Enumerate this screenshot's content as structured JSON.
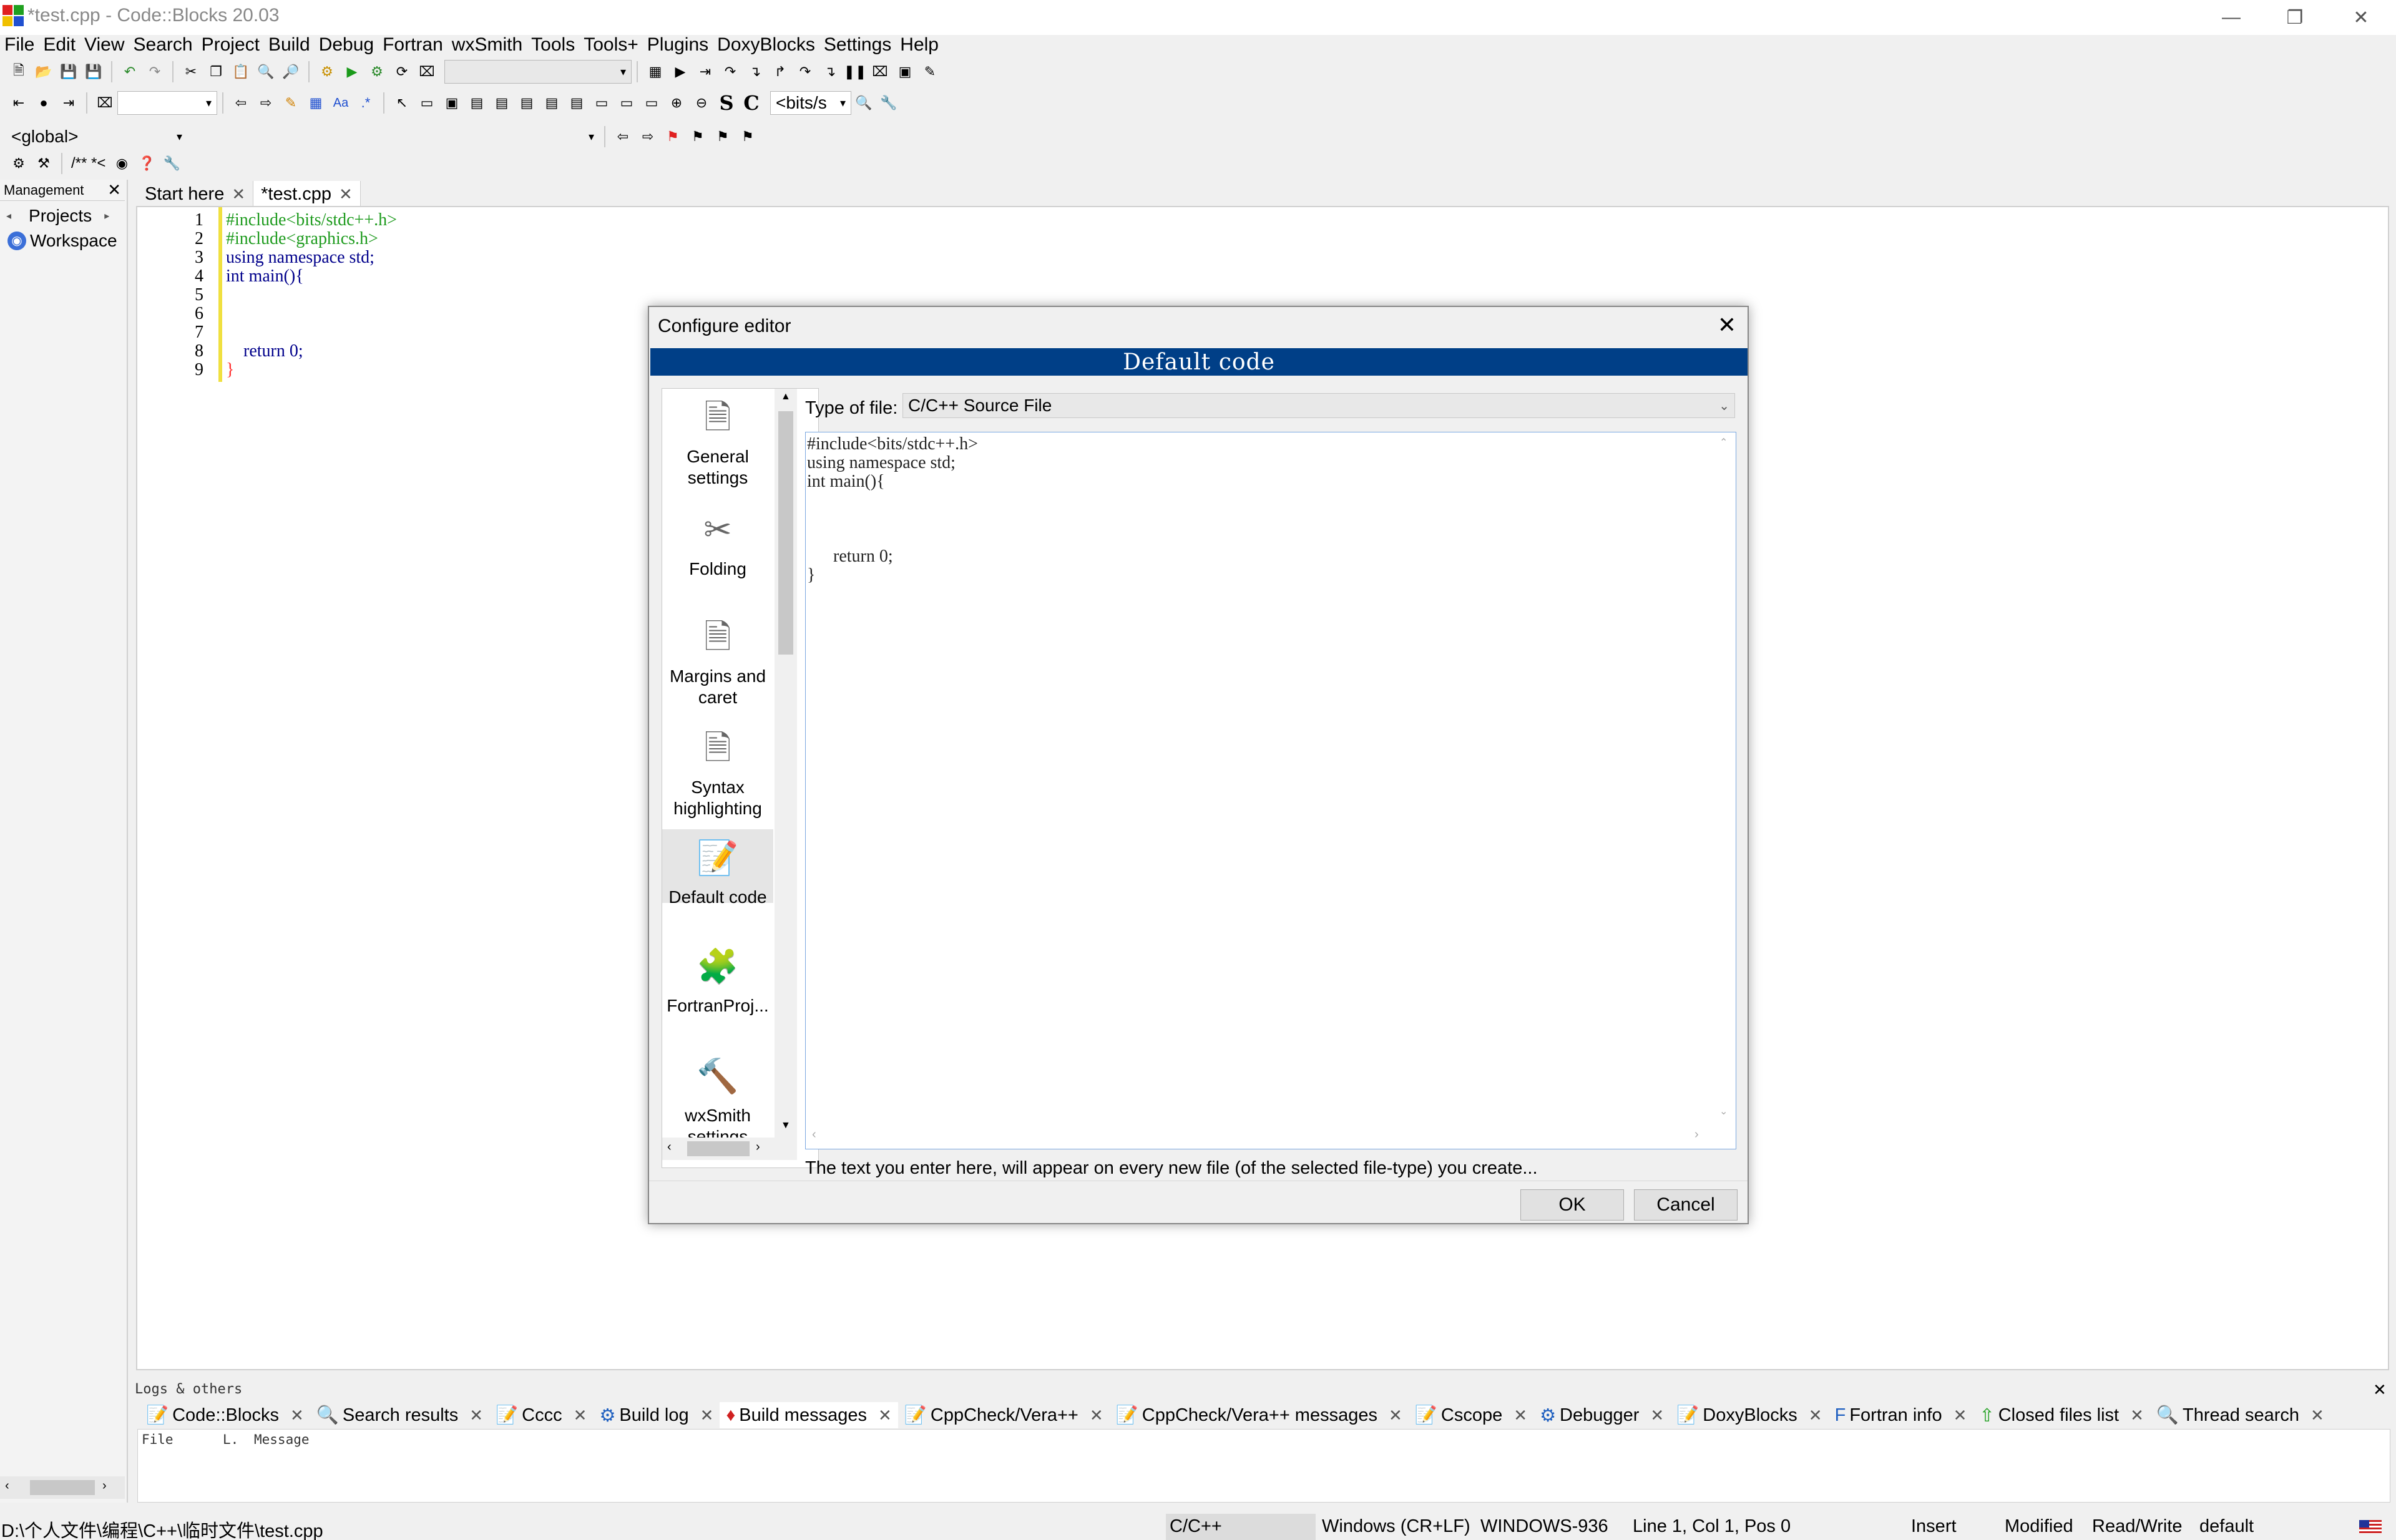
{
  "window": {
    "title": "*test.cpp - Code::Blocks 20.03"
  },
  "menu": [
    "File",
    "Edit",
    "View",
    "Search",
    "Project",
    "Build",
    "Debug",
    "Fortran",
    "wxSmith",
    "Tools",
    "Tools+",
    "Plugins",
    "DoxyBlocks",
    "Settings",
    "Help"
  ],
  "toolbar": {
    "scope_combo": "<global>",
    "bits_combo": "<bits/s",
    "comment_text": "/** *<",
    "s_label": "S",
    "c_label": "C"
  },
  "management": {
    "title": "Management",
    "tab": "Projects",
    "workspace": "Workspace"
  },
  "editor": {
    "tabs": [
      "Start here",
      "*test.cpp"
    ],
    "lines": [
      {
        "n": "1",
        "text": "#include<bits/stdc++.h>",
        "color": "#1e9b1e"
      },
      {
        "n": "2",
        "text": "#include<graphics.h>",
        "color": "#1e9b1e"
      },
      {
        "n": "3",
        "text": "using namespace std;",
        "color": "#00008b"
      },
      {
        "n": "4",
        "text": "int main(){",
        "color": "#00008b"
      },
      {
        "n": "5",
        "text": "",
        "color": "#000"
      },
      {
        "n": "6",
        "text": "",
        "color": "#000"
      },
      {
        "n": "7",
        "text": "",
        "color": "#000"
      },
      {
        "n": "8",
        "text": "    return 0;",
        "color": "#00008b"
      },
      {
        "n": "9",
        "text": "}",
        "color": "#ff3030"
      }
    ]
  },
  "dialog": {
    "title": "Configure editor",
    "banner": "Default code",
    "pages": [
      {
        "label": "General settings",
        "icon": "general-settings-icon"
      },
      {
        "label": "Folding",
        "icon": "folding-icon"
      },
      {
        "label": "Margins and caret",
        "icon": "margins-icon"
      },
      {
        "label": "Syntax highlighting",
        "icon": "syntax-highlighting-icon"
      },
      {
        "label": "Default code",
        "icon": "default-code-icon"
      },
      {
        "label": "FortranProj...",
        "icon": "fortran-project-icon"
      },
      {
        "label": "wxSmith settings",
        "icon": "wxsmith-icon"
      }
    ],
    "file_type_label": "Type of file:",
    "file_type_value": "C/C++ Source File",
    "default_code": "#include<bits/stdc++.h>\nusing namespace std;\nint main(){\n\n\n\n\treturn 0;\n}",
    "hint": "The text you enter here, will appear on every new file (of the selected file-type) you create...",
    "ok": "OK",
    "cancel": "Cancel"
  },
  "logs": {
    "title": "Logs & others",
    "tabs": [
      "Code::Blocks",
      "Search results",
      "Cccc",
      "Build log",
      "Build messages",
      "CppCheck/Vera++",
      "CppCheck/Vera++ messages",
      "Cscope",
      "Debugger",
      "DoxyBlocks",
      "Fortran info",
      "Closed files list",
      "Thread search"
    ],
    "columns": [
      "File",
      "L.",
      "Message"
    ]
  },
  "status": {
    "path": "D:\\个人文件\\编程\\C++\\临时文件\\test.cpp",
    "lang": "C/C++",
    "eol": "Windows (CR+LF)",
    "encoding": "WINDOWS-936",
    "position": "Line 1, Col 1, Pos 0",
    "mode": "Insert",
    "modified": "Modified",
    "rw": "Read/Write",
    "profile": "default"
  }
}
